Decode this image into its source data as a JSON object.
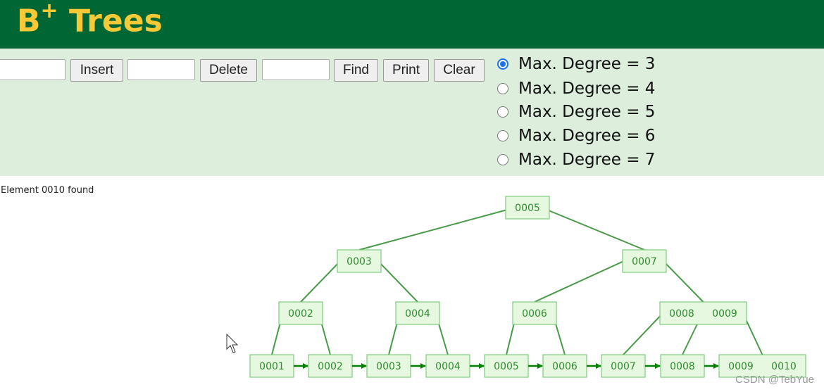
{
  "header": {
    "title": "B",
    "title_sup": "+",
    "title_rest": " Trees"
  },
  "controls": {
    "insert_label": "Insert",
    "delete_label": "Delete",
    "find_label": "Find",
    "print_label": "Print",
    "clear_label": "Clear",
    "insert_value": "",
    "delete_value": "",
    "find_value": ""
  },
  "degrees": [
    {
      "label": "Max. Degree = 3",
      "checked": true
    },
    {
      "label": "Max. Degree = 4",
      "checked": false
    },
    {
      "label": "Max. Degree = 5",
      "checked": false
    },
    {
      "label": "Max. Degree = 6",
      "checked": false
    },
    {
      "label": "Max. Degree = 7",
      "checked": false
    }
  ],
  "status": "Element 0010 found",
  "tree": {
    "levels": [
      [
        [
          "0005"
        ]
      ],
      [
        [
          "0003"
        ],
        [
          "0007"
        ]
      ],
      [
        [
          "0002"
        ],
        [
          "0004"
        ],
        [
          "0006"
        ],
        [
          "0008",
          "0009"
        ]
      ],
      [
        [
          "0001"
        ],
        [
          "0002"
        ],
        [
          "0003"
        ],
        [
          "0004"
        ],
        [
          "0005"
        ],
        [
          "0006"
        ],
        [
          "0007"
        ],
        [
          "0008"
        ],
        [
          "0009",
          "0010"
        ]
      ]
    ],
    "colors": {
      "node_fill": "#e6f9e0",
      "node_stroke": "#7fcc7f",
      "edge": "#4a9a4a",
      "text": "#2e8b2e",
      "arrow": "#008000"
    }
  },
  "watermark": "CSDN @TebYue"
}
